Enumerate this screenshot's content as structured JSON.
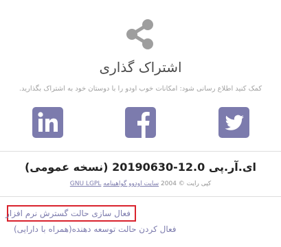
{
  "share": {
    "title": "اشتراک گذاری",
    "subtitle": "کمک کنید اطلاع رسانی شود: امکانات خوب اودو را با دوستان خود به اشتراک بگذارید."
  },
  "social": [
    {
      "name": "linkedin-icon"
    },
    {
      "name": "facebook-icon"
    },
    {
      "name": "twitter-icon"
    }
  ],
  "about": {
    "version": "ای.آر.پی 12.0-20190630 (نسخه عمومی)",
    "copyright_prefix": "کپی رایت © 2004",
    "copyright_company": "سایت اودوو گواهینامه",
    "license": "GNU LGPL"
  },
  "developer": {
    "activate_label": "فعال سازی حالت گسترش نرم افزار",
    "activate_assets_label": "فعال کردن حالت توسعه دهنده(همراه با دارایی)"
  },
  "colors": {
    "brand": "#7c7bad",
    "icon_grey": "#9e9e9e",
    "highlight": "#d9222c"
  }
}
